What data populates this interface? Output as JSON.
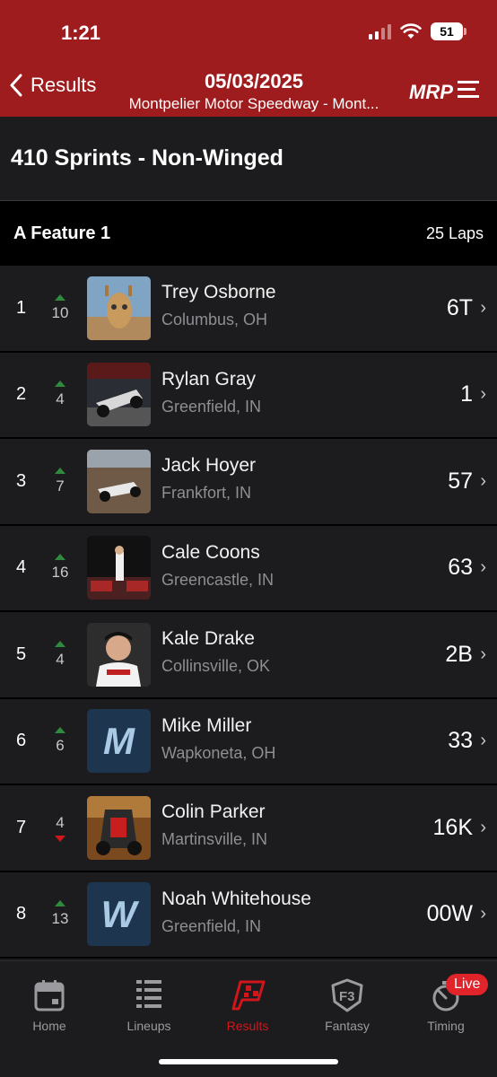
{
  "status": {
    "time": "1:21",
    "battery": "51"
  },
  "nav": {
    "back_label": "Results",
    "date": "05/03/2025",
    "track": "Montpelier Motor Speedway - Mont...",
    "logo_text": "MRP"
  },
  "class_title": "410 Sprints - Non-Winged",
  "feature": {
    "name": "A Feature 1",
    "laps": "25 Laps"
  },
  "results": [
    {
      "pos": "1",
      "move": "10",
      "dir": "up",
      "name": "Trey Osborne",
      "home": "Columbus, OH",
      "car": "6T"
    },
    {
      "pos": "2",
      "move": "4",
      "dir": "up",
      "name": "Rylan Gray",
      "home": "Greenfield, IN",
      "car": "1"
    },
    {
      "pos": "3",
      "move": "7",
      "dir": "up",
      "name": "Jack Hoyer",
      "home": "Frankfort, IN",
      "car": "57"
    },
    {
      "pos": "4",
      "move": "16",
      "dir": "up",
      "name": "Cale Coons",
      "home": "Greencastle, IN",
      "car": "63"
    },
    {
      "pos": "5",
      "move": "4",
      "dir": "up",
      "name": "Kale Drake",
      "home": "Collinsville, OK",
      "car": "2B"
    },
    {
      "pos": "6",
      "move": "6",
      "dir": "up",
      "name": "Mike Miller",
      "home": "Wapkoneta, OH",
      "car": "33",
      "initial": "M"
    },
    {
      "pos": "7",
      "move": "4",
      "dir": "down",
      "name": "Colin Parker",
      "home": "Martinsville, IN",
      "car": "16K"
    },
    {
      "pos": "8",
      "move": "13",
      "dir": "up",
      "name": "Noah Whitehouse",
      "home": "Greenfield, IN",
      "car": "00W",
      "initial": "W"
    }
  ],
  "tabs": [
    {
      "label": "Home",
      "icon": "calendar-icon"
    },
    {
      "label": "Lineups",
      "icon": "lineups-icon"
    },
    {
      "label": "Results",
      "icon": "checkered-flag-icon"
    },
    {
      "label": "Fantasy",
      "icon": "fantasy-icon"
    },
    {
      "label": "Timing",
      "icon": "stopwatch-icon"
    }
  ],
  "live_badge": "Live",
  "colors": {
    "header": "#9e1c1e",
    "accent": "#d0161b",
    "up": "#2e8b3e",
    "down": "#d0161b"
  }
}
